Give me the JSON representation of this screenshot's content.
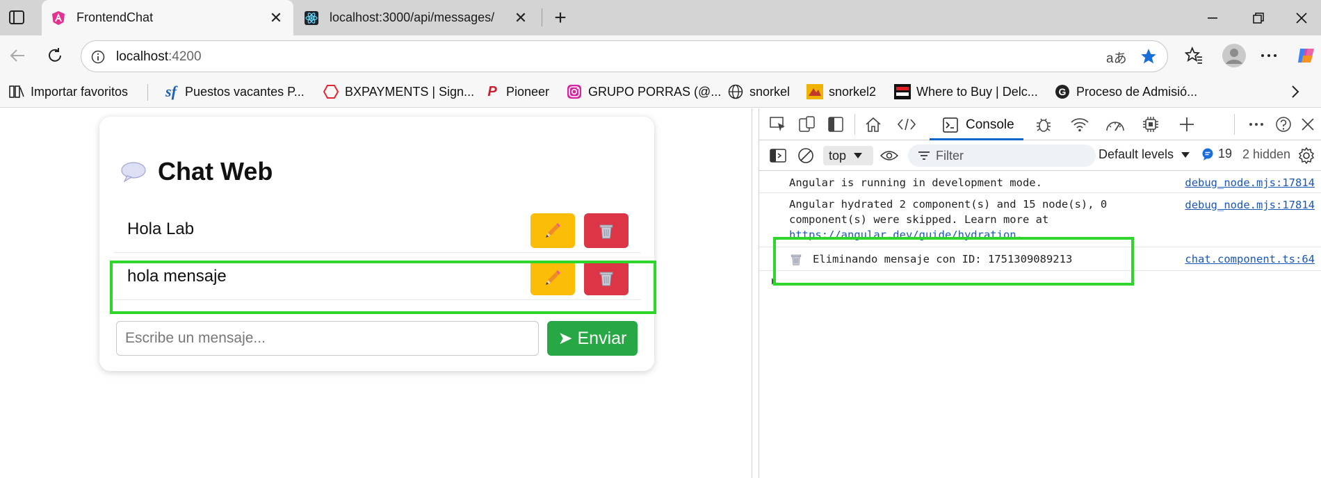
{
  "browser": {
    "tabs": [
      {
        "title": "FrontendChat",
        "active": true,
        "icon": "angular-icon"
      },
      {
        "title": "localhost:3000/api/messages/",
        "active": false,
        "icon": "react-icon"
      }
    ],
    "address": {
      "host": "localhost",
      "port": ":4200"
    },
    "bookmarks": [
      {
        "label": "Importar favoritos",
        "icon": "import-favorites-icon"
      },
      {
        "label": "Puestos vacantes P...",
        "icon": "sf-icon"
      },
      {
        "label": "BXPAYMENTS | Sign...",
        "icon": "hexagon-icon"
      },
      {
        "label": "Pioneer",
        "icon": "pioneer-icon"
      },
      {
        "label": "GRUPO PORRAS (@...",
        "icon": "instagram-icon"
      },
      {
        "label": "snorkel",
        "icon": "globe-icon"
      },
      {
        "label": "snorkel2",
        "icon": "snorkel2-icon"
      },
      {
        "label": "Where to Buy | Delc...",
        "icon": "delco-icon"
      },
      {
        "label": "Proceso de Admisió...",
        "icon": "g-icon"
      }
    ]
  },
  "app": {
    "title": "Chat Web",
    "messages": [
      {
        "text": "Hola Lab"
      },
      {
        "text": "hola mensaje"
      }
    ],
    "input_placeholder": "Escribe un mensaje...",
    "send_label": "➤ Enviar",
    "colors": {
      "edit": "#fbbd08",
      "delete": "#dc3545",
      "send": "#28a745",
      "highlight": "#2ed62b"
    }
  },
  "devtools": {
    "active_tab": "Console",
    "context": "top",
    "filter_placeholder": "Filter",
    "levels": "Default levels",
    "issues_count": "19",
    "hidden": "2 hidden",
    "logs": [
      {
        "lines": [
          "Angular is running in development mode."
        ],
        "source": "debug_node.mjs:17814"
      },
      {
        "lines": [
          "Angular hydrated 2 component(s) and 15 node(s), 0",
          "component(s) were skipped. Learn more at"
        ],
        "link": "https://angular.dev/guide/hydration",
        "link_suffix": ".",
        "source": "debug_node.mjs:17814"
      },
      {
        "lines": [
          "Eliminando mensaje con ID: 1751309089213"
        ],
        "source": "chat.component.ts:64",
        "icon": "trash-icon"
      }
    ]
  }
}
